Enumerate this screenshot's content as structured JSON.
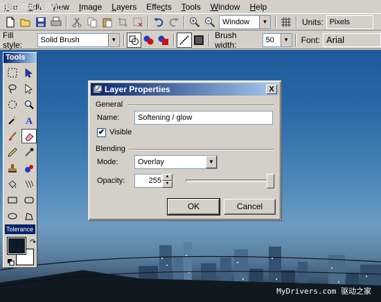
{
  "watermark_top": "陈胜的网人网页",
  "watermark_bottom": "MyDrivers.com 驱动之家",
  "menu": {
    "items": [
      {
        "pre": "",
        "u": "F",
        "post": "ile"
      },
      {
        "pre": "",
        "u": "E",
        "post": "dit"
      },
      {
        "pre": "",
        "u": "V",
        "post": "iew"
      },
      {
        "pre": "",
        "u": "I",
        "post": "mage"
      },
      {
        "pre": "",
        "u": "L",
        "post": "ayers"
      },
      {
        "pre": "Effe",
        "u": "c",
        "post": "ts"
      },
      {
        "pre": "",
        "u": "T",
        "post": "ools"
      },
      {
        "pre": "",
        "u": "W",
        "post": "indow"
      },
      {
        "pre": "",
        "u": "H",
        "post": "elp"
      }
    ]
  },
  "toolbar": {
    "window_combo": "Window",
    "units_label": "Units:",
    "units_value": "Pixels",
    "fill_style_label": "Fill style:",
    "fill_style_value": "Solid Brush",
    "brush_width_label": "Brush width:",
    "brush_width_value": "50",
    "font_label": "Font:",
    "font_value": "Arial"
  },
  "tools": {
    "title": "Tools",
    "tolerance_label": "Tolerance"
  },
  "dialog": {
    "title": "Layer Properties",
    "close_label": "X",
    "general_label": "General",
    "name_label": "Name:",
    "name_value": "Softening / glow",
    "visible_label": "Visible",
    "visible_checked": "✔",
    "blending_label": "Blending",
    "mode_label": "Mode:",
    "mode_value": "Overlay",
    "opacity_label": "Opacity:",
    "opacity_value": "255",
    "opacity_fraction": 1.0,
    "ok_label": "OK",
    "cancel_label": "Cancel"
  }
}
